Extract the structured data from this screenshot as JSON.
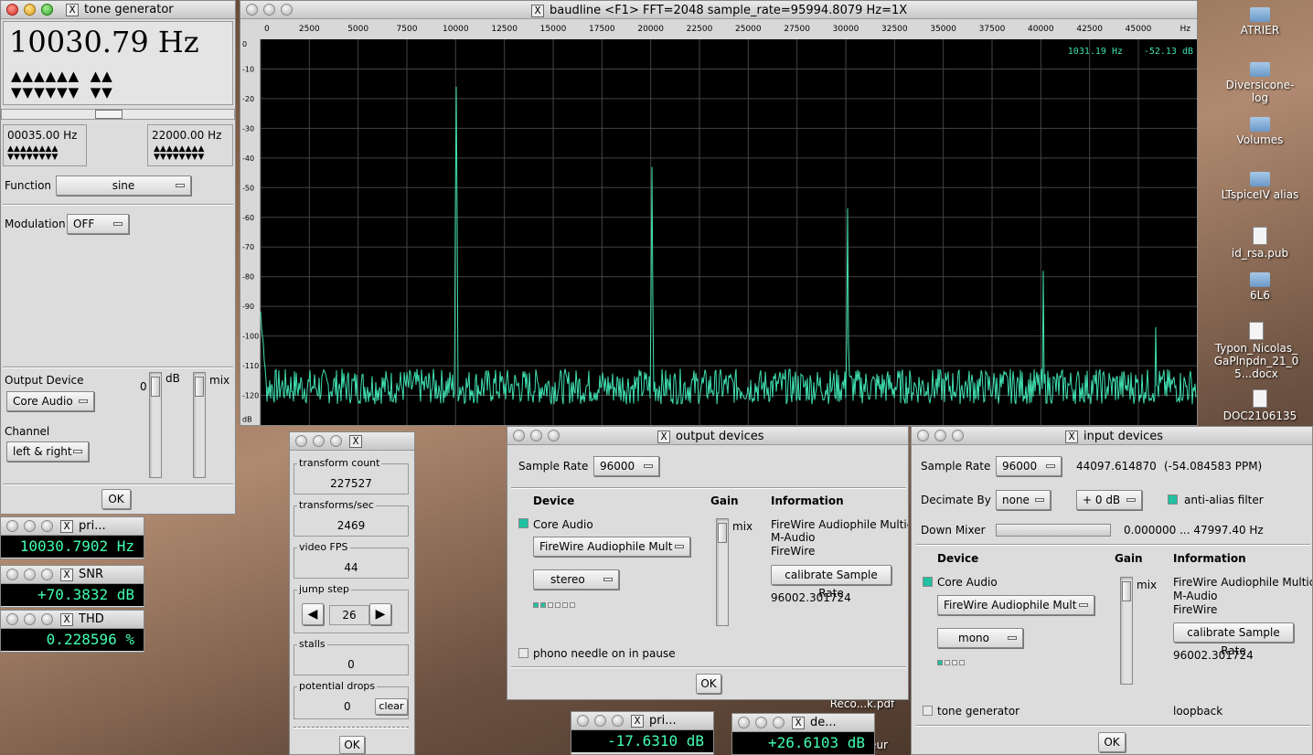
{
  "tone": {
    "title": "tone generator",
    "freq": "10030.79 Hz",
    "lo": "00035.00 Hz",
    "hi": "22000.00 Hz",
    "function_label": "Function",
    "function_value": "sine",
    "modulation_label": "Modulation",
    "modulation_value": "OFF",
    "output_label": "Output Device",
    "output_value": "Core Audio",
    "channel_label": "Channel",
    "channel_value": "left & right",
    "db_label": "dB",
    "zero_label": "0",
    "mix_label": "mix",
    "ok": "OK"
  },
  "baudline": {
    "title": "baudline  <F1> FFT=2048 sample_rate=95994.8079 Hz=1X",
    "cursor_freq": "1031.19 Hz",
    "cursor_db": "-52.13 dB",
    "x_ticks": [
      "0",
      "2500",
      "5000",
      "7500",
      "10000",
      "12500",
      "15000",
      "17500",
      "20000",
      "22500",
      "25000",
      "27500",
      "30000",
      "32500",
      "35000",
      "37500",
      "40000",
      "42500",
      "45000",
      "Hz"
    ],
    "y_ticks": [
      "0",
      "-10",
      "-20",
      "-30",
      "-40",
      "-50",
      "-60",
      "-70",
      "-80",
      "-90",
      "-100",
      "-110",
      "-120",
      "dB"
    ]
  },
  "stats": {
    "transform_count_label": "transform count",
    "transform_count": "227527",
    "tps_label": "transforms/sec",
    "tps": "2469",
    "fps_label": "video FPS",
    "fps": "44",
    "jump_label": "jump step",
    "jump": "26",
    "stalls_label": "stalls",
    "stalls": "0",
    "drops_label": "potential drops",
    "drops": "0",
    "clear": "clear",
    "ok": "OK"
  },
  "output_dev": {
    "title": "output devices",
    "sample_rate_label": "Sample Rate",
    "sample_rate": "96000",
    "device_h": "Device",
    "gain_h": "Gain",
    "info_h": "Information",
    "core_audio": "Core Audio",
    "device_select": "FireWire Audiophile Mult",
    "mode": "stereo",
    "mix": "mix",
    "info1": "FireWire Audiophile Multic",
    "info2": "M-Audio",
    "info3": "FireWire",
    "calibrate": "calibrate Sample Rate",
    "rate": "96002.301724",
    "phono": "phono needle on in pause",
    "ok": "OK"
  },
  "input_dev": {
    "title": "input devices",
    "sample_rate_label": "Sample Rate",
    "sample_rate": "96000",
    "measured": "44097.614870",
    "ppm": "(-54.084583 PPM)",
    "decimate_label": "Decimate By",
    "decimate": "none",
    "gain_sel": "+ 0 dB",
    "anti_alias": "anti-alias filter",
    "down_mixer_label": "Down Mixer",
    "down_mixer_value": "0.000000 ... 47997.40 Hz",
    "device_h": "Device",
    "gain_h": "Gain",
    "info_h": "Information",
    "core_audio": "Core Audio",
    "device_select": "FireWire Audiophile Mult",
    "mode": "mono",
    "mix": "mix",
    "info1": "FireWire Audiophile Multic",
    "info2": "M-Audio",
    "info3": "FireWire",
    "calibrate": "calibrate Sample Rate",
    "rate": "96002.301724",
    "tone_gen": "tone generator",
    "loopback": "loopback",
    "ok": "OK"
  },
  "meters": {
    "pri1_title": "pri...",
    "pri1_value": "10030.7902 Hz",
    "snr_title": "SNR",
    "snr_value": "+70.3832 dB",
    "thd_title": "THD",
    "thd_value": "0.228596 %",
    "pri2_title": "pri...",
    "pri2_value": "-17.6310 dB",
    "de_title": "de...",
    "de_value": "+26.6103 dB"
  },
  "desktop": {
    "items": [
      "ATRIER",
      "Diversicone-log",
      "Volumes",
      "LTspiceIV alias",
      "id_rsa.pub",
      "6L6",
      "Typon_Nicolas_GaPlnpdn_21_05...docx",
      "DOC2106135"
    ],
    "reco": "Reco...k.pdf",
    "ateur": "ateur"
  },
  "chart_data": {
    "type": "line",
    "xlabel": "Hz",
    "ylabel": "dB",
    "xlim": [
      0,
      48000
    ],
    "ylim": [
      -130,
      0
    ],
    "peaks": [
      {
        "x": 10030,
        "y": -16
      },
      {
        "x": 20060,
        "y": -43
      },
      {
        "x": 30090,
        "y": -57
      },
      {
        "x": 40120,
        "y": -78
      },
      {
        "x": 45900,
        "y": -97
      }
    ],
    "noise_floor": -117,
    "low_freq_start": -92
  }
}
